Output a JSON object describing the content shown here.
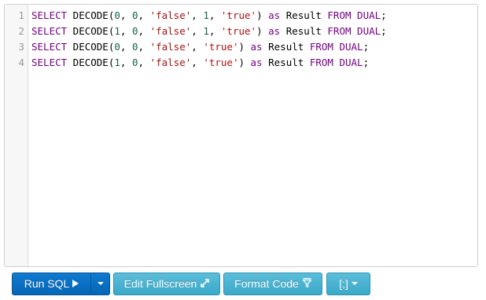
{
  "editor": {
    "line_numbers": [
      "1",
      "2",
      "3",
      "4"
    ],
    "lines": [
      [
        {
          "t": "SELECT",
          "c": "kw"
        },
        {
          "t": " DECODE(",
          "c": ""
        },
        {
          "t": "0",
          "c": "num"
        },
        {
          "t": ", ",
          "c": ""
        },
        {
          "t": "0",
          "c": "num"
        },
        {
          "t": ", ",
          "c": ""
        },
        {
          "t": "'false'",
          "c": "str"
        },
        {
          "t": ", ",
          "c": ""
        },
        {
          "t": "1",
          "c": "num"
        },
        {
          "t": ", ",
          "c": ""
        },
        {
          "t": "'true'",
          "c": "str"
        },
        {
          "t": ") ",
          "c": ""
        },
        {
          "t": "as",
          "c": "kw"
        },
        {
          "t": " Result ",
          "c": ""
        },
        {
          "t": "FROM",
          "c": "kw"
        },
        {
          "t": " ",
          "c": ""
        },
        {
          "t": "DUAL",
          "c": "kw"
        },
        {
          "t": ";",
          "c": ""
        }
      ],
      [
        {
          "t": "SELECT",
          "c": "kw"
        },
        {
          "t": " DECODE(",
          "c": ""
        },
        {
          "t": "1",
          "c": "num"
        },
        {
          "t": ", ",
          "c": ""
        },
        {
          "t": "0",
          "c": "num"
        },
        {
          "t": ", ",
          "c": ""
        },
        {
          "t": "'false'",
          "c": "str"
        },
        {
          "t": ", ",
          "c": ""
        },
        {
          "t": "1",
          "c": "num"
        },
        {
          "t": ", ",
          "c": ""
        },
        {
          "t": "'true'",
          "c": "str"
        },
        {
          "t": ") ",
          "c": ""
        },
        {
          "t": "as",
          "c": "kw"
        },
        {
          "t": " Result ",
          "c": ""
        },
        {
          "t": "FROM",
          "c": "kw"
        },
        {
          "t": " ",
          "c": ""
        },
        {
          "t": "DUAL",
          "c": "kw"
        },
        {
          "t": ";",
          "c": ""
        }
      ],
      [
        {
          "t": "SELECT",
          "c": "kw"
        },
        {
          "t": " DECODE(",
          "c": ""
        },
        {
          "t": "0",
          "c": "num"
        },
        {
          "t": ", ",
          "c": ""
        },
        {
          "t": "0",
          "c": "num"
        },
        {
          "t": ", ",
          "c": ""
        },
        {
          "t": "'false'",
          "c": "str"
        },
        {
          "t": ", ",
          "c": ""
        },
        {
          "t": "'true'",
          "c": "str"
        },
        {
          "t": ") ",
          "c": ""
        },
        {
          "t": "as",
          "c": "kw"
        },
        {
          "t": " Result ",
          "c": ""
        },
        {
          "t": "FROM",
          "c": "kw"
        },
        {
          "t": " ",
          "c": ""
        },
        {
          "t": "DUAL",
          "c": "kw"
        },
        {
          "t": ";",
          "c": ""
        }
      ],
      [
        {
          "t": "SELECT",
          "c": "kw"
        },
        {
          "t": " DECODE(",
          "c": ""
        },
        {
          "t": "1",
          "c": "num"
        },
        {
          "t": ", ",
          "c": ""
        },
        {
          "t": "0",
          "c": "num"
        },
        {
          "t": ", ",
          "c": ""
        },
        {
          "t": "'false'",
          "c": "str"
        },
        {
          "t": ", ",
          "c": ""
        },
        {
          "t": "'true'",
          "c": "str"
        },
        {
          "t": ") ",
          "c": ""
        },
        {
          "t": "as",
          "c": "kw"
        },
        {
          "t": " Result ",
          "c": ""
        },
        {
          "t": "FROM",
          "c": "kw"
        },
        {
          "t": " ",
          "c": ""
        },
        {
          "t": "DUAL",
          "c": "kw"
        },
        {
          "t": ";",
          "c": ""
        }
      ]
    ]
  },
  "toolbar": {
    "run_label": "Run SQL",
    "run_icon": "play-icon",
    "run_dropdown_icon": "caret-down-icon",
    "fullscreen_label": "Edit Fullscreen",
    "fullscreen_icon": "expand-arrows-icon",
    "format_label": "Format Code",
    "format_icon": "filter-icon",
    "delimiter_label": "[;]",
    "delimiter_icon": "caret-down-icon"
  },
  "colors": {
    "primary_button": "#0566b6",
    "info_button": "#3aa9c8",
    "sql_keyword": "#770088",
    "sql_number": "#116644",
    "sql_string": "#aa1111"
  }
}
